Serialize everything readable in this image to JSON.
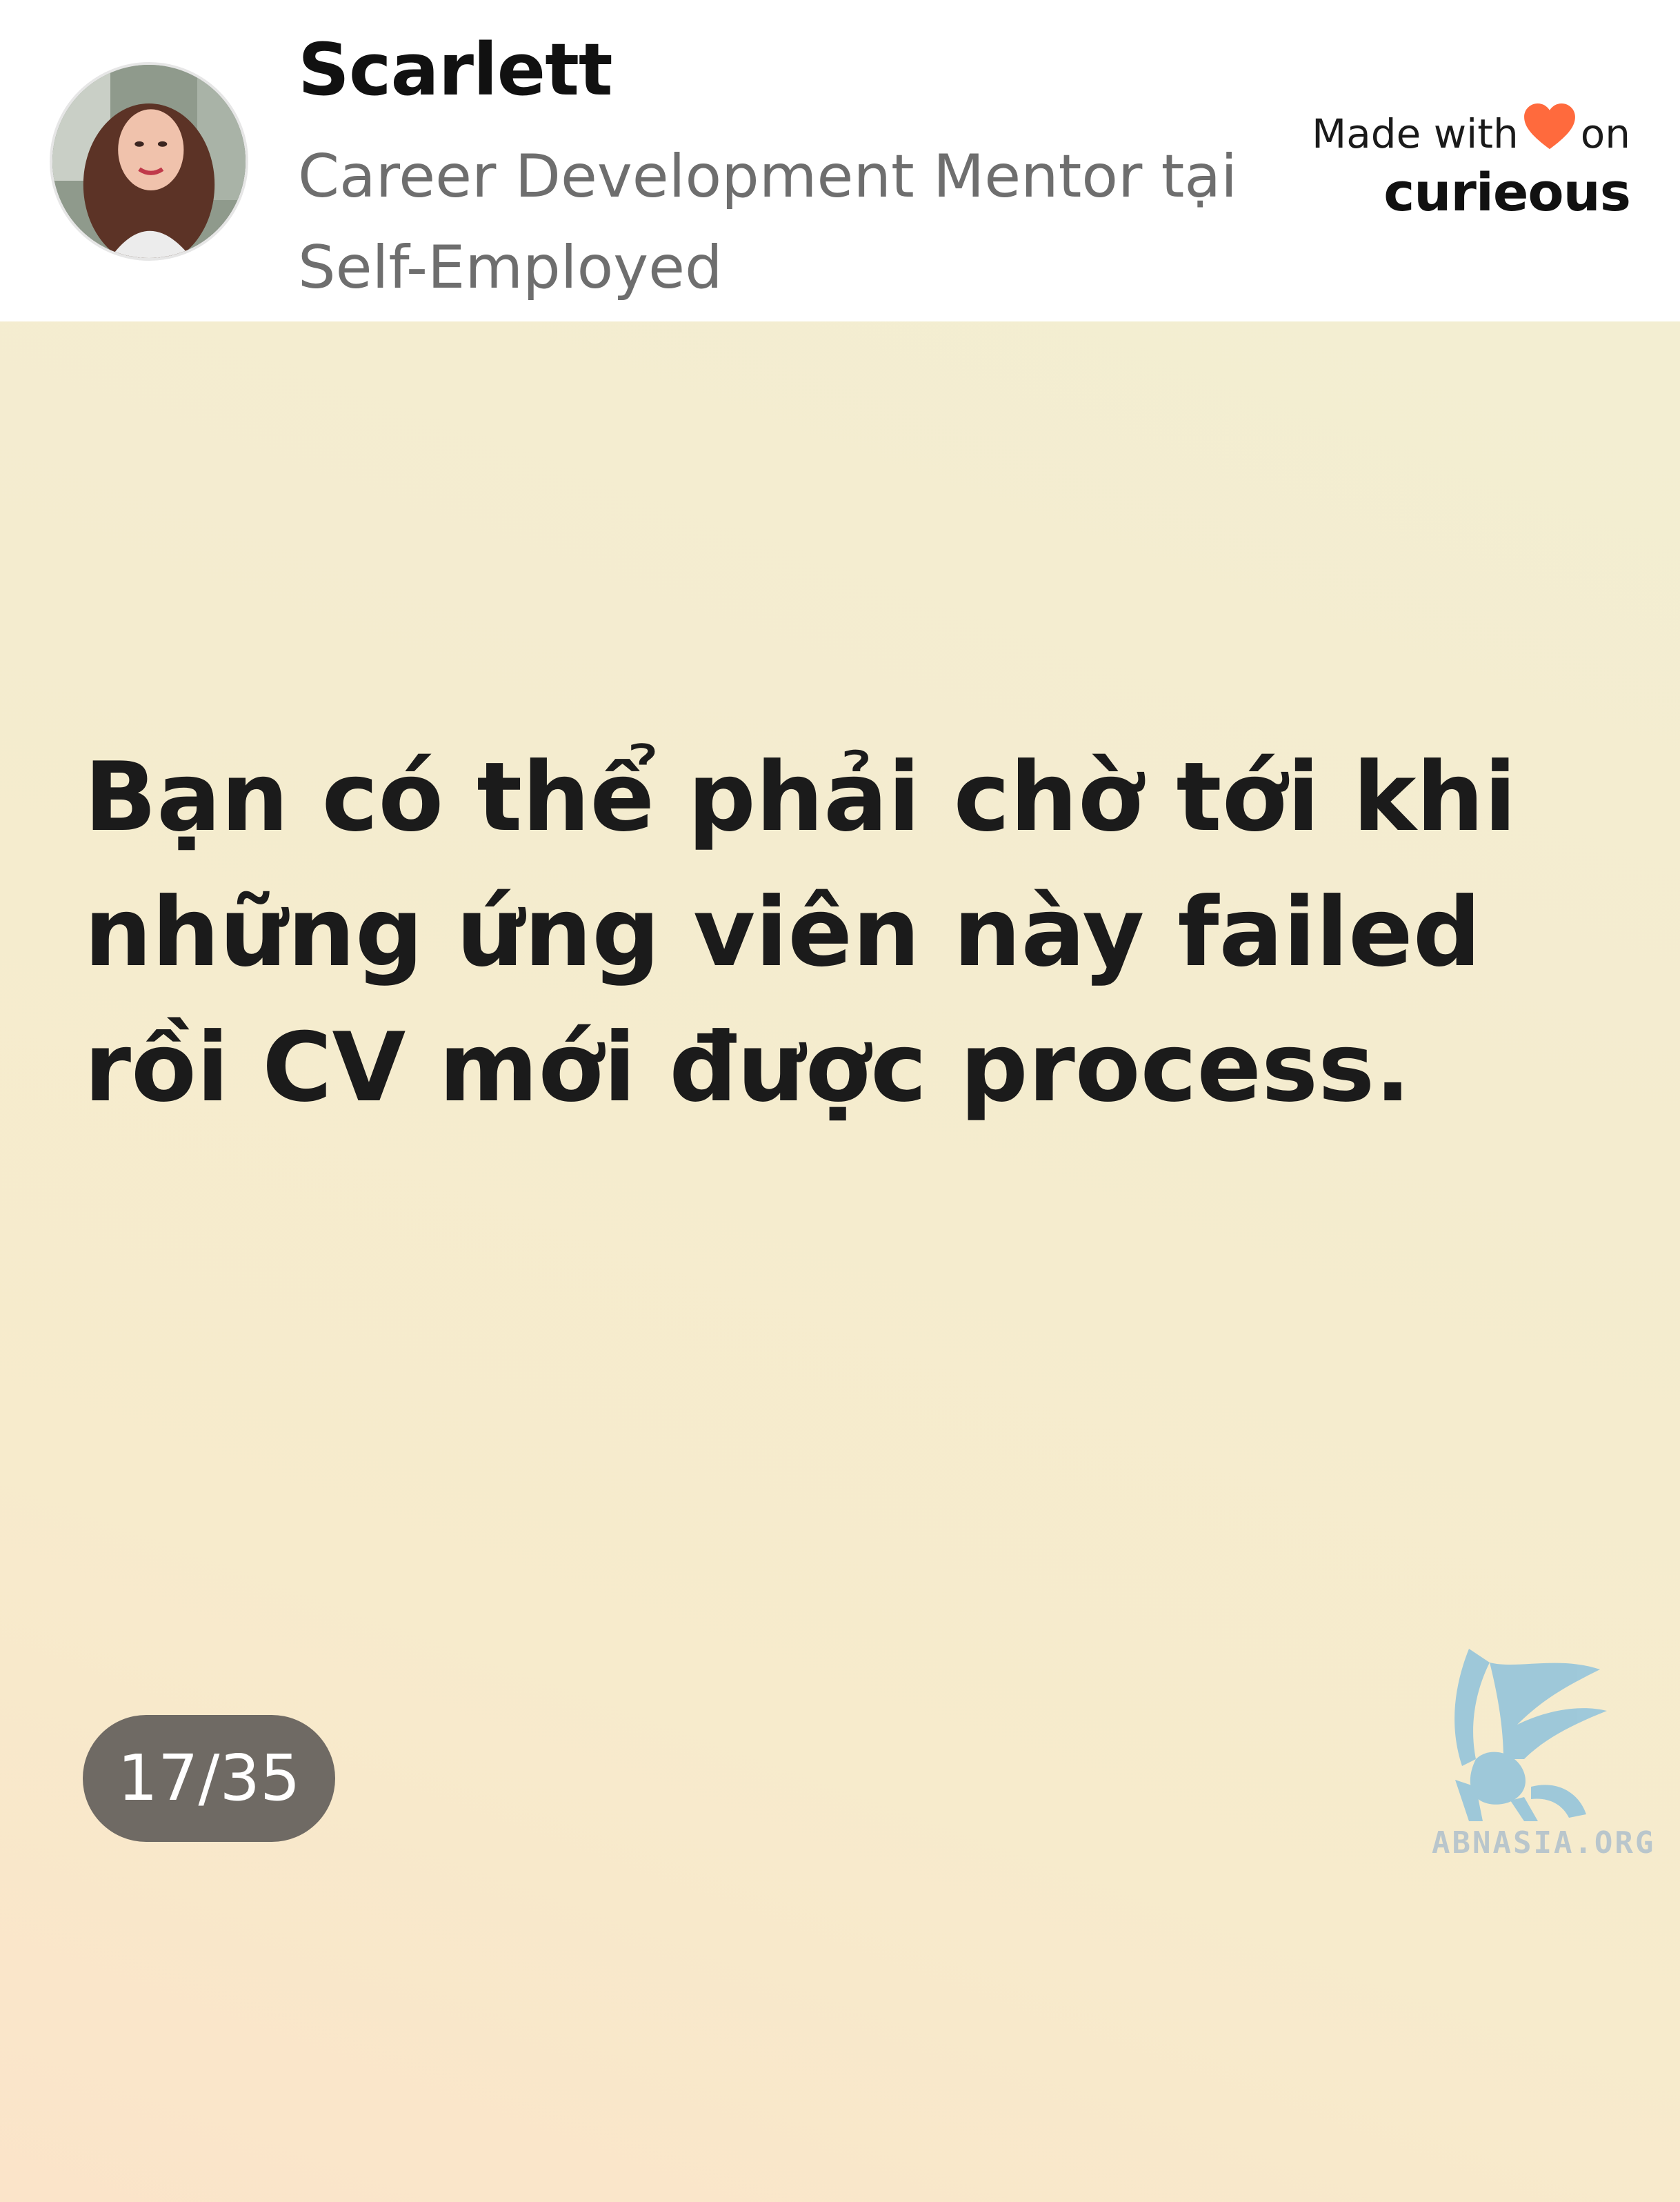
{
  "header": {
    "author_name": "Scarlett",
    "author_title": "Career Development Mentor tại Self-Employed",
    "brand": {
      "made_with": "Made with",
      "on": "on",
      "name": "curieous",
      "heart_icon": "heart-icon",
      "heart_color": "#ff6a3d"
    }
  },
  "card": {
    "quote": "Bạn có thể phải chờ tới khi những ứng viên này failed rồi CV mới được process.",
    "page_counter": "17/35",
    "watermark": "ABNASIA.ORG"
  },
  "colors": {
    "card_background": "#f4eccf",
    "counter_background": "#6f6a64",
    "watermark": "#8fc3dc"
  }
}
